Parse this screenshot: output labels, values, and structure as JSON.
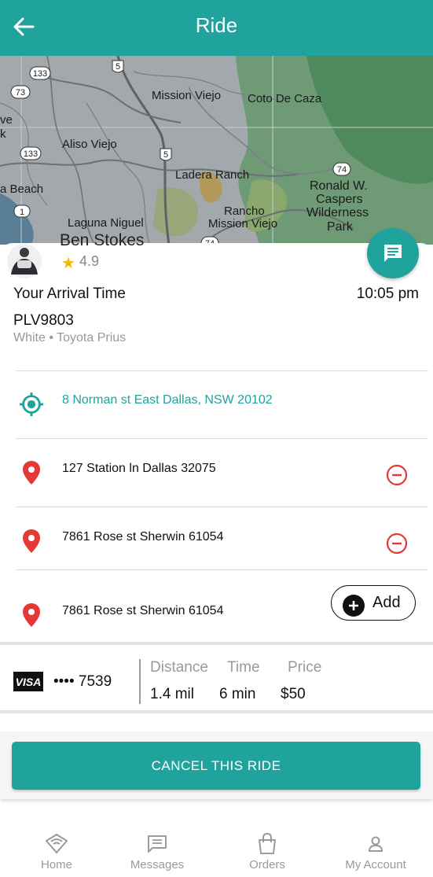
{
  "header": {
    "title": "Ride"
  },
  "map": {
    "labels": {
      "mission_viejo": "Mission Viejo",
      "coto_de_caza": "Coto De Caza",
      "aliso_viejo": "Aliso Viejo",
      "ladera_ranch": "Ladera Ranch",
      "ronald_w": "Ronald W.",
      "caspers": "Caspers",
      "wilderness": "Wilderness",
      "park": "Park",
      "laguna_niguel": "Laguna Niguel",
      "rancho": "Rancho",
      "rancho_mission_viejo": "Mission Viejo",
      "beach": "a Beach",
      "ve": "ve",
      "k": "k"
    },
    "shields": {
      "r5a": "5",
      "r5b": "5",
      "r73": "73",
      "r133a": "133",
      "r133b": "133",
      "r1": "1",
      "r74a": "74",
      "r74b": "74"
    }
  },
  "driver": {
    "name": "Ben Stokes",
    "rating": "4.9"
  },
  "ride": {
    "arrival_label": "Your Arrival Time",
    "arrival_time": "10:05 pm",
    "plate": "PLV9803",
    "car": "White • Toyota Prius"
  },
  "stops": [
    {
      "address": "8 Norman st East Dallas, NSW 20102"
    },
    {
      "address": "127 Station ln Dallas 32075"
    },
    {
      "address": "7861 Rose st Sherwin 61054"
    },
    {
      "address": "7861 Rose st Sherwin 61054"
    }
  ],
  "add_label": "Add",
  "payment": {
    "brand": "VISA",
    "card_mask": "•••• 7539",
    "distance_label": "Distance",
    "distance": "1.4 mil",
    "time_label": "Time",
    "time": "6 min",
    "price_label": "Price",
    "price": "$50"
  },
  "cancel_label": "CANCEL THIS RIDE",
  "tabs": [
    {
      "label": "Home",
      "icon": "home-icon"
    },
    {
      "label": "Messages",
      "icon": "messages-icon"
    },
    {
      "label": "Orders",
      "icon": "bag-icon"
    },
    {
      "label": "My Account",
      "icon": "account-icon"
    }
  ],
  "colors": {
    "primary": "#1fa39c",
    "danger": "#e53935",
    "pin": "#e53935"
  }
}
